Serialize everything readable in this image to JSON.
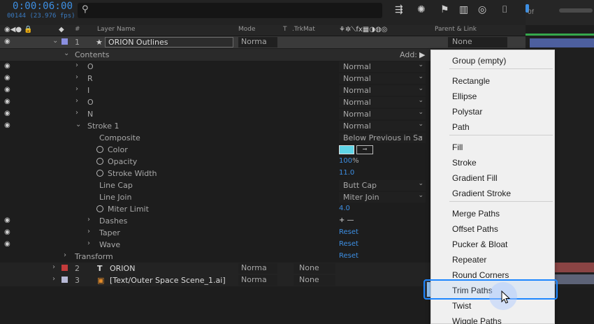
{
  "topbar": {
    "timecode": "0:00:06:00",
    "fps": "00144 (23.976 fps)",
    "search_icon": "search-icon",
    "timeline_label": "0f"
  },
  "header": {
    "layer_name": "Layer Name",
    "mode": "Mode",
    "t": "T",
    "trkmat": ".TrkMat",
    "parent_link": "Parent & Link",
    "num": "#"
  },
  "rows": {
    "orion_outlines": {
      "num": "1",
      "name": "ORION Outlines",
      "mode": "Norma",
      "parent": "None"
    },
    "contents": {
      "label": "Contents",
      "add": "Add:"
    },
    "o1": {
      "label": "O",
      "mode": "Normal"
    },
    "r": {
      "label": "R",
      "mode": "Normal"
    },
    "i": {
      "label": "I",
      "mode": "Normal"
    },
    "o2": {
      "label": "O",
      "mode": "Normal"
    },
    "n": {
      "label": "N",
      "mode": "Normal"
    },
    "stroke1": {
      "label": "Stroke 1",
      "mode": "Normal"
    },
    "composite": {
      "label": "Composite",
      "value": "Below Previous in Sa"
    },
    "color": {
      "label": "Color",
      "swatch": "#5fd4e6"
    },
    "opacity": {
      "label": "Opacity",
      "value": "100",
      "unit": "%"
    },
    "stroke_width": {
      "label": "Stroke Width",
      "value": "11.0"
    },
    "line_cap": {
      "label": "Line Cap",
      "value": "Butt Cap"
    },
    "line_join": {
      "label": "Line Join",
      "value": "Miter Join"
    },
    "miter_limit": {
      "label": "Miter Limit",
      "value": "4.0"
    },
    "dashes": {
      "label": "Dashes",
      "value": "+ —"
    },
    "taper": {
      "label": "Taper",
      "value": "Reset"
    },
    "wave": {
      "label": "Wave",
      "value": "Reset"
    },
    "transform": {
      "label": "Transform",
      "value": "Reset"
    },
    "orion": {
      "num": "2",
      "name": "ORION",
      "mode": "Norma",
      "trkmat": "None",
      "color": "#c23b3b"
    },
    "text_outer": {
      "num": "3",
      "name": "[Text/Outer Space Scene_1.ai]",
      "mode": "Norma",
      "trkmat": "None",
      "color": "#b7b9d6"
    }
  },
  "menu": {
    "items": [
      "Group (empty)",
      "Rectangle",
      "Ellipse",
      "Polystar",
      "Path",
      "Fill",
      "Stroke",
      "Gradient Fill",
      "Gradient Stroke",
      "Merge Paths",
      "Offset Paths",
      "Pucker & Bloat",
      "Repeater",
      "Round Corners",
      "Trim Paths",
      "Twist",
      "Wiggle Paths"
    ],
    "highlighted": "Trim Paths"
  },
  "colors": {
    "accent": "#3d8fe3",
    "layer1_label": "#8a8fe0",
    "highlight": "#1d86ff"
  }
}
